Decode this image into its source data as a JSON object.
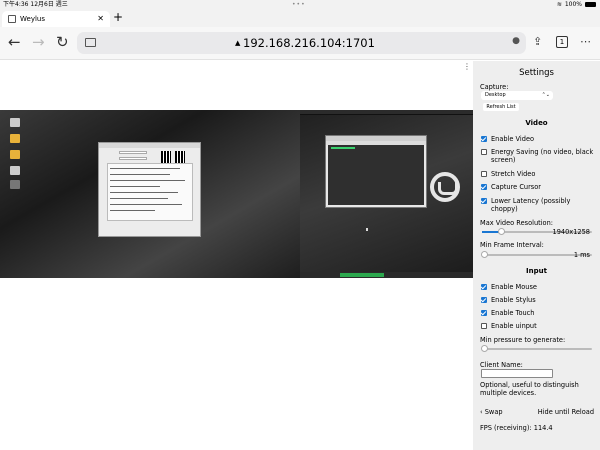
{
  "status_bar": {
    "time": "下午4:36  12月6日 週三",
    "battery": "100%"
  },
  "tab": {
    "title": "Weylus",
    "close": "✕",
    "new_tab": "+"
  },
  "toolbar": {
    "back": "←",
    "forward": "→",
    "reload": "↻",
    "lock": "▲",
    "url": "192.168.216.104:1701",
    "mic": "●",
    "share": "⇪",
    "tab_count": "1",
    "more": "⋯"
  },
  "settings": {
    "title": "Settings",
    "capture_label": "Capture:",
    "capture_value": "Desktop",
    "refresh_label": "Refresh List",
    "video_heading": "Video",
    "video_options": [
      {
        "label": "Enable Video",
        "checked": true
      },
      {
        "label": "Energy Saving (no video, black screen)",
        "checked": false
      },
      {
        "label": "Stretch Video",
        "checked": false
      },
      {
        "label": "Capture Cursor",
        "checked": true
      },
      {
        "label": "Lower Latency (possibly choppy)",
        "checked": true
      }
    ],
    "max_res_label": "Max Video Resolution:",
    "max_res_value": "1940x1258",
    "max_res_level": 0.17,
    "min_frame_label": "Min Frame Interval:",
    "min_frame_value": "1 ms",
    "min_frame_level": 0.02,
    "input_heading": "Input",
    "input_options": [
      {
        "label": "Enable Mouse",
        "checked": true
      },
      {
        "label": "Enable Stylus",
        "checked": true
      },
      {
        "label": "Enable Touch",
        "checked": true
      },
      {
        "label": "Enable uinput",
        "checked": false
      }
    ],
    "min_pressure_label": "Min pressure to generate:",
    "min_pressure_level": 0.02,
    "client_name_label": "Client Name:",
    "client_name_value": "",
    "client_name_note": "Optional, useful to distinguish multiple devices.",
    "swap_label": "Swap",
    "hide_label": "Hide until Reload",
    "fps_text": "FPS (receiving): 114.4"
  }
}
